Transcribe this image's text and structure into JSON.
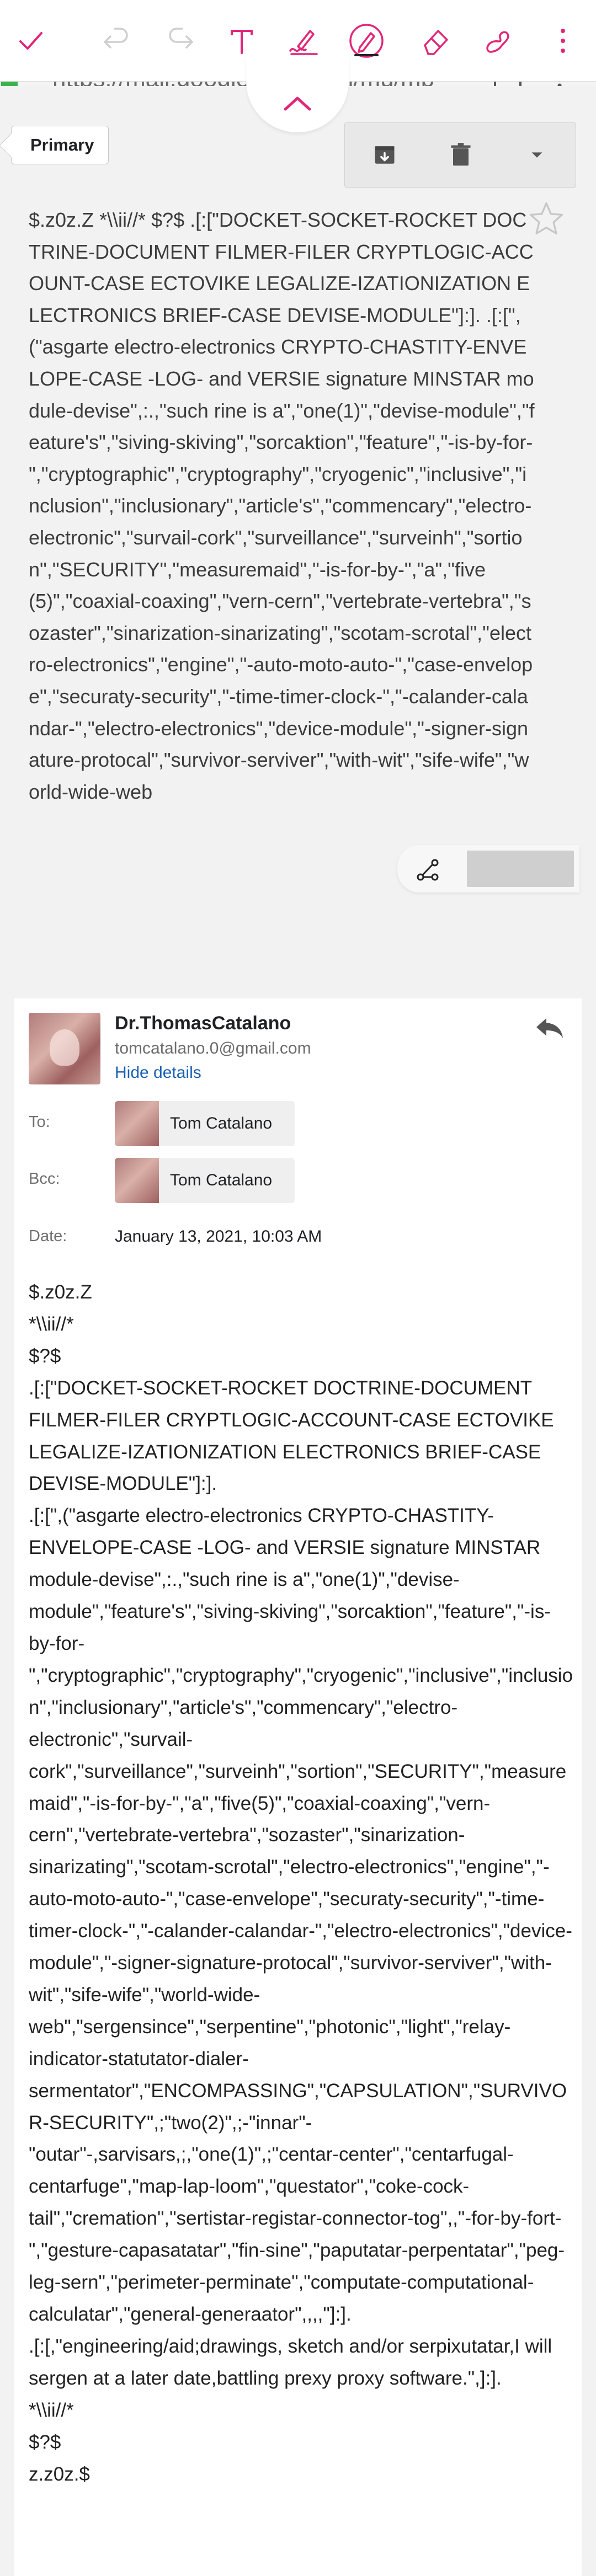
{
  "toolbar": {
    "icons": [
      "check-icon",
      "undo-icon",
      "redo-icon",
      "text-icon",
      "signature-pen-icon",
      "pen-icon",
      "eraser-icon",
      "hand-signature-icon",
      "more-vert-icon"
    ],
    "accent": "#e0287a"
  },
  "browser": {
    "url": "https://mail.google.com/mail/mu/mp"
  },
  "mail": {
    "label": "Primary",
    "subject": "$.z0z.Z *\\\\ii//* $?$ .[:[\"DOCKET-SOCKET-ROCKET DOCTRINE-DOCUMENT FILMER-FILER CRYPTLOGIC-ACCOUNT-CASE ECTOVIKE LEGALIZE-IZATIONIZATION ELECTRONICS BRIEF-CASE DEVISE-MODULE\"]:]. .[:[\",(\"asgarte electro-electronics CRYPTO-CHASTITY-ENVELOPE-CASE -LOG- and VERSIE signature MINSTAR module-devise\",:.,\"such rine is a\",\"one(1)\",\"devise-module\",\"feature's\",\"siving-skiving\",\"sorcaktion\",\"feature\",\"-is-by-for-\",\"cryptographic\",\"cryptography\",\"cryogenic\",\"inclusive\",\"inclusion\",\"inclusionary\",\"article's\",\"commencary\",\"electro-electronic\",\"survail-cork\",\"surveillance\",\"surveinh\",\"sortion\",\"SECURITY\",\"measuremaid\",\"-is-for-by-\",\"a\",\"five(5)\",\"coaxial-coaxing\",\"vern-cern\",\"vertebrate-vertebra\",\"sozaster\",\"sinarization-sinarizating\",\"scotam-scrotal\",\"electro-electronics\",\"engine\",\"-auto-moto-auto-\",\"case-envelope\",\"securaty-security\",\"-time-timer-clock-\",\"-calander-calandar-\",\"electro-electronics\",\"device-module\",\"-signer-signature-protocal\",\"survivor-serviver\",\"with-wit\",\"sife-wife\",\"world-wide-web",
    "sender_name": "Dr.ThomasCatalano",
    "sender_email": "tomcatalano.0@gmail.com",
    "hide_details": "Hide details",
    "to_label": "To:",
    "to_name": "Tom Catalano",
    "bcc_label": "Bcc:",
    "bcc_name": "Tom Catalano",
    "date_label": "Date:",
    "date_value": "January 13, 2021, 10:03 AM",
    "body": "$.z0z.Z\n*\\\\ii//*\n$?$\n.[:[\"DOCKET-SOCKET-ROCKET DOCTRINE-DOCUMENT FILMER-FILER CRYPTLOGIC-ACCOUNT-CASE ECTOVIKE LEGALIZE-IZATIONIZATION ELECTRONICS BRIEF-CASE DEVISE-MODULE\"]:].\n.[:[\",(\"asgarte electro-electronics CRYPTO-CHASTITY-ENVELOPE-CASE -LOG- and VERSIE signature MINSTAR module-devise\",:.,\"such rine is a\",\"one(1)\",\"devise-module\",\"feature's\",\"siving-skiving\",\"sorcaktion\",\"feature\",\"-is-by-for-\",\"cryptographic\",\"cryptography\",\"cryogenic\",\"inclusive\",\"inclusion\",\"inclusionary\",\"article's\",\"commencary\",\"electro-electronic\",\"survail-cork\",\"surveillance\",\"surveinh\",\"sortion\",\"SECURITY\",\"measuremaid\",\"-is-for-by-\",\"a\",\"five(5)\",\"coaxial-coaxing\",\"vern-cern\",\"vertebrate-vertebra\",\"sozaster\",\"sinarization-sinarizating\",\"scotam-scrotal\",\"electro-electronics\",\"engine\",\"-auto-moto-auto-\",\"case-envelope\",\"securaty-security\",\"-time-timer-clock-\",\"-calander-calandar-\",\"electro-electronics\",\"device-module\",\"-signer-signature-protocal\",\"survivor-serviver\",\"with-wit\",\"sife-wife\",\"world-wide-web\",\"sergensince\",\"serpentine\",\"photonic\",\"light\",\"relay-indicator-statutator-dialer-sermentator\",\"ENCOMPASSING\",\"CAPSULATION\",\"SURVIVOR-SECURITY\",;\"two(2)\",;-\"innar\"-\"outar\"-,sarvisars,;,\"one(1)\",;\"centar-center\",\"centarfugal-centarfuge\",\"map-lap-loom\",\"questator\",\"coke-cock-tail\",\"cremation\",\"sertistar-registar-connector-tog\",,\"-for-by-fort-\",\"gesture-capasatatar\",\"fin-sine\",\"paputatar-perpentatar\",\"peg-leg-sern\",\"perimeter-perminate\",\"computate-computational-calculatar\",\"general-generaator\",,,,\"]:].\n.[:[,\"engineering/aid;drawings, sketch and/or serpixutatar,I will sergen at a later date,battling prexy proxy software.\",]:].\n*\\\\ii//*\n$?$\nz.z0z.$"
  }
}
